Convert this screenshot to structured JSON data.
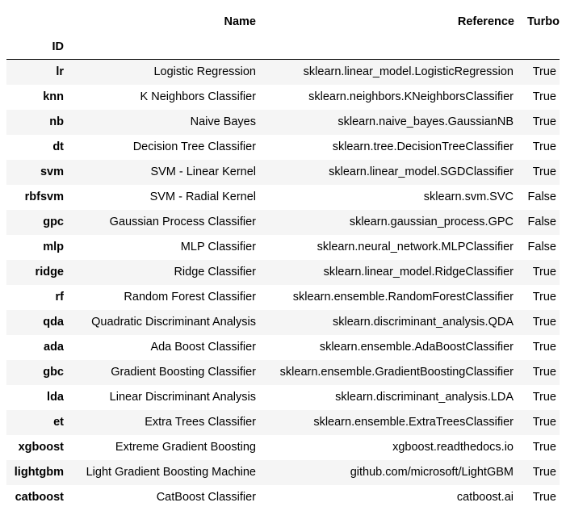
{
  "table": {
    "columns": {
      "name": "Name",
      "reference": "Reference",
      "turbo": "Turbo"
    },
    "index_label": "ID",
    "rows": [
      {
        "id": "lr",
        "name": "Logistic Regression",
        "reference": "sklearn.linear_model.LogisticRegression",
        "turbo": "True"
      },
      {
        "id": "knn",
        "name": "K Neighbors Classifier",
        "reference": "sklearn.neighbors.KNeighborsClassifier",
        "turbo": "True"
      },
      {
        "id": "nb",
        "name": "Naive Bayes",
        "reference": "sklearn.naive_bayes.GaussianNB",
        "turbo": "True"
      },
      {
        "id": "dt",
        "name": "Decision Tree Classifier",
        "reference": "sklearn.tree.DecisionTreeClassifier",
        "turbo": "True"
      },
      {
        "id": "svm",
        "name": "SVM - Linear Kernel",
        "reference": "sklearn.linear_model.SGDClassifier",
        "turbo": "True"
      },
      {
        "id": "rbfsvm",
        "name": "SVM - Radial Kernel",
        "reference": "sklearn.svm.SVC",
        "turbo": "False"
      },
      {
        "id": "gpc",
        "name": "Gaussian Process Classifier",
        "reference": "sklearn.gaussian_process.GPC",
        "turbo": "False"
      },
      {
        "id": "mlp",
        "name": "MLP Classifier",
        "reference": "sklearn.neural_network.MLPClassifier",
        "turbo": "False"
      },
      {
        "id": "ridge",
        "name": "Ridge Classifier",
        "reference": "sklearn.linear_model.RidgeClassifier",
        "turbo": "True"
      },
      {
        "id": "rf",
        "name": "Random Forest Classifier",
        "reference": "sklearn.ensemble.RandomForestClassifier",
        "turbo": "True"
      },
      {
        "id": "qda",
        "name": "Quadratic Discriminant Analysis",
        "reference": "sklearn.discriminant_analysis.QDA",
        "turbo": "True"
      },
      {
        "id": "ada",
        "name": "Ada Boost Classifier",
        "reference": "sklearn.ensemble.AdaBoostClassifier",
        "turbo": "True"
      },
      {
        "id": "gbc",
        "name": "Gradient Boosting Classifier",
        "reference": "sklearn.ensemble.GradientBoostingClassifier",
        "turbo": "True"
      },
      {
        "id": "lda",
        "name": "Linear Discriminant Analysis",
        "reference": "sklearn.discriminant_analysis.LDA",
        "turbo": "True"
      },
      {
        "id": "et",
        "name": "Extra Trees Classifier",
        "reference": "sklearn.ensemble.ExtraTreesClassifier",
        "turbo": "True"
      },
      {
        "id": "xgboost",
        "name": "Extreme Gradient Boosting",
        "reference": "xgboost.readthedocs.io",
        "turbo": "True"
      },
      {
        "id": "lightgbm",
        "name": "Light Gradient Boosting Machine",
        "reference": "github.com/microsoft/LightGBM",
        "turbo": "True"
      },
      {
        "id": "catboost",
        "name": "CatBoost Classifier",
        "reference": "catboost.ai",
        "turbo": "True"
      }
    ]
  },
  "colors": {
    "stripe": "#f5f5f5",
    "text": "#000000",
    "header_rule": "#000000"
  }
}
